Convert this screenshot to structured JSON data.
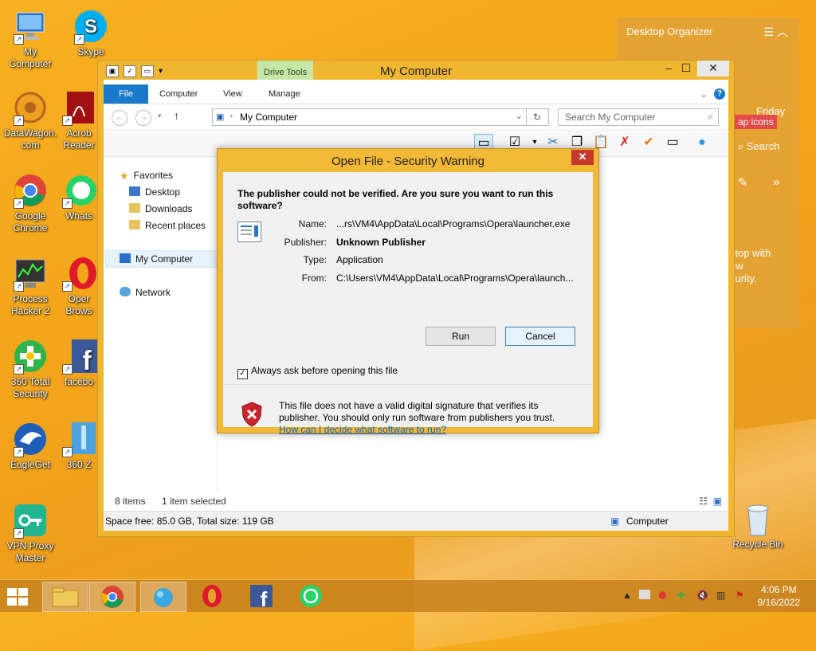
{
  "desktop": {
    "icons_left": [
      {
        "label": "My\nComputer"
      },
      {
        "label": "DataWagon.\ncom"
      },
      {
        "label": "Google\nChrome"
      },
      {
        "label": "Process\nHacker 2"
      },
      {
        "label": "360 Total\nSecurity"
      },
      {
        "label": "EagleGet"
      },
      {
        "label": "VPN Proxy\nMaster"
      }
    ],
    "icons_col2": [
      {
        "label": "Skype"
      },
      {
        "label": "Acrob\nReader"
      },
      {
        "label": "Whats"
      },
      {
        "label": "Oper\nBrows"
      },
      {
        "label": "facebo"
      },
      {
        "label": "360 Z"
      }
    ],
    "recycle_bin": "Recycle Bin"
  },
  "explorer": {
    "title": "My Computer",
    "drive_tools": "Drive Tools",
    "tabs": [
      "File",
      "Computer",
      "View",
      "Manage"
    ],
    "address": "My Computer",
    "search_placeholder": "Search My Computer",
    "nav": {
      "favorites": "Favorites",
      "desktop": "Desktop",
      "downloads": "Downloads",
      "recent": "Recent places",
      "my_computer": "My Computer",
      "network": "Network"
    },
    "status": {
      "items": "8 items",
      "selected": "1 item selected"
    },
    "info": {
      "space": "Space free: 85.0 GB, Total size: 119 GB",
      "location": "Computer"
    }
  },
  "dialog": {
    "title": "Open File - Security Warning",
    "question": "The publisher could not be verified.  Are you sure you want to run this software?",
    "fields": {
      "name_label": "Name:",
      "name_value": "...rs\\VM4\\AppData\\Local\\Programs\\Opera\\launcher.exe",
      "publisher_label": "Publisher:",
      "publisher_value": "Unknown Publisher",
      "type_label": "Type:",
      "type_value": "Application",
      "from_label": "From:",
      "from_value": "C:\\Users\\VM4\\AppData\\Local\\Programs\\Opera\\launch..."
    },
    "run": "Run",
    "cancel": "Cancel",
    "checkbox": "Always ask before opening this file",
    "warning": "This file does not have a valid digital signature that verifies its publisher.  You should only run software from publishers you trust.",
    "link": "How can I decide what software to run?"
  },
  "organizer": {
    "title": "Desktop Organizer",
    "day": "Friday",
    "tab_icons": "ap icons",
    "search": "Search",
    "desc1": "ktop with",
    "desc2": "ew",
    "desc3": "curity."
  },
  "clock": {
    "time": "4:06 PM",
    "date": "9/16/2022"
  },
  "colors": {
    "accent": "#1979ca",
    "dialog_frame": "#f2b937",
    "close_red": "#c7392b"
  }
}
